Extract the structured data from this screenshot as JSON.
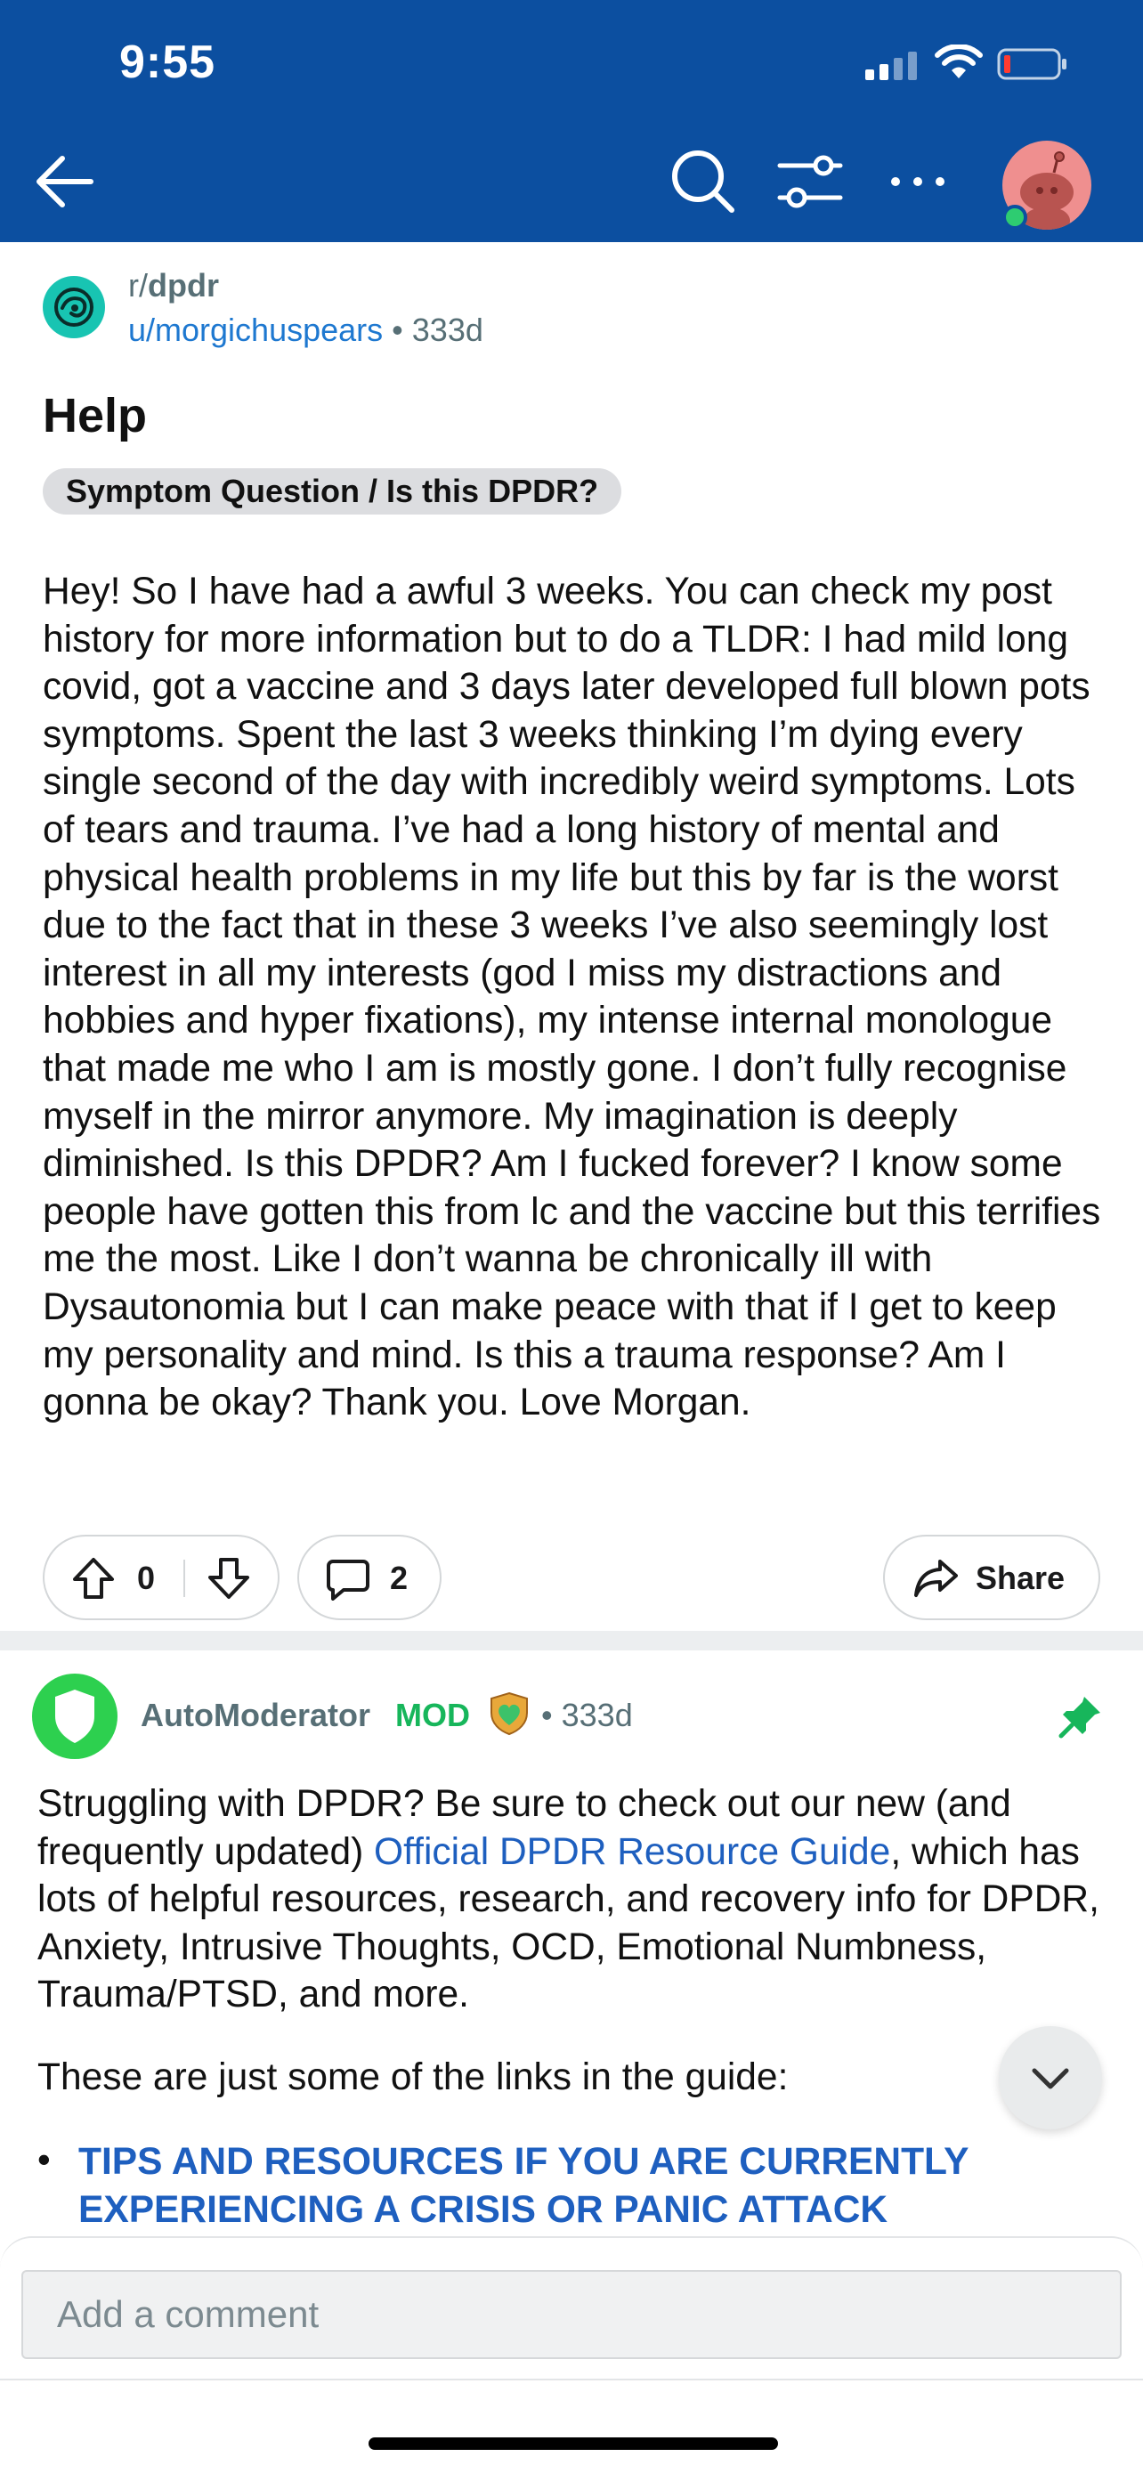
{
  "status_bar": {
    "time": "9:55"
  },
  "nav": {
    "back_icon": "arrow-left",
    "search_icon": "search",
    "filter_icon": "sliders",
    "more_icon": "ellipsis"
  },
  "post": {
    "subreddit": "r/dpdr",
    "subreddit_prefix": "r/",
    "subreddit_name": "dpdr",
    "author": "u/morgichuspears",
    "separator": "•",
    "age": "333d",
    "title": "Help",
    "flair": "Symptom Question / Is this DPDR?",
    "body": "Hey! So I have had a awful 3 weeks. You can check my post history for more information but to do a TLDR: I had mild long covid, got a vaccine and 3 days later developed full blown pots symptoms. Spent the last 3 weeks thinking I’m dying every single second of the day with incredibly weird symptoms. Lots of tears and trauma. I’ve had a long history of mental and physical health problems in my life but this by far is the worst due to the fact that in these 3 weeks I’ve also seemingly lost interest in all my interests (god I miss my distractions and hobbies and hyper fixations), my intense internal monologue that made me who I am is mostly gone. I don’t fully recognise myself in the mirror anymore. My imagination is deeply diminished. Is this DPDR? Am I fucked forever? I know some people have gotten this from lc and the vaccine but this terrifies me the most. Like I don’t wanna be chronically ill with Dysautonomia but I can make peace with that if I get to keep my personality and mind. Is this a trauma response? Am I gonna be okay? Thank you. Love Morgan.",
    "score": "0",
    "comment_count": "2",
    "share_label": "Share"
  },
  "comment": {
    "author": "AutoModerator",
    "mod_tag": "MOD",
    "separator": "•",
    "age": "333d",
    "body_part1": "Struggling with DPDR? Be sure to check out our new (and frequently updated) ",
    "body_link": "Official DPDR Resource Guide",
    "body_part2": ", which has lots of helpful resources, research, and recovery info for DPDR, Anxiety, Intrusive Thoughts, OCD, Emotional Numbness, Trauma/PTSD, and more.",
    "links_intro": "These are just some of the links in the guide:",
    "bullet": "•",
    "crisis_link": "TIPS AND RESOURCES IF YOU ARE CURRENTLY EXPERIENCING A CRISIS OR PANIC ATTACK"
  },
  "composer": {
    "placeholder": "Add a comment"
  },
  "colors": {
    "header_bg": "#0c4fa0",
    "link_blue": "#1e78d0",
    "mod_green": "#17b65b",
    "subreddit_icon": "#18c4b2"
  }
}
